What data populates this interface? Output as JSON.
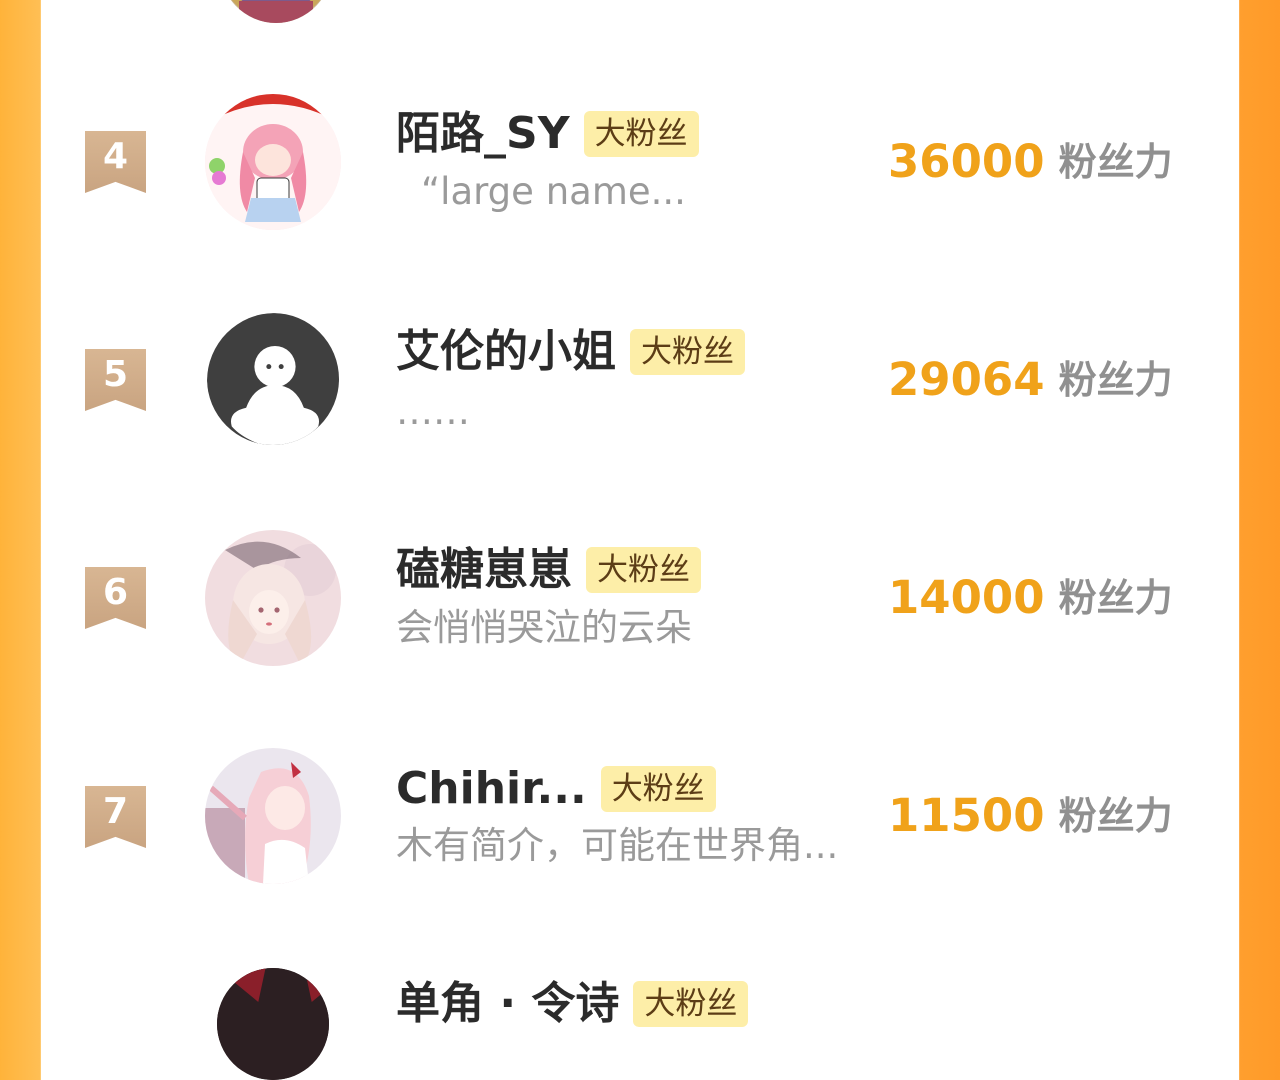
{
  "score_unit": "粉丝力",
  "badge_label": "大粉丝",
  "rows": [
    {
      "rank": "4",
      "name": "陌路_SY",
      "bio": "“large name...",
      "score": "36000",
      "avatar": "anime-girl-avatar"
    },
    {
      "rank": "5",
      "name": "艾伦的小姐",
      "bio": "……",
      "score": "29064",
      "avatar": "default-user-avatar"
    },
    {
      "rank": "6",
      "name": "磕糖崽崽",
      "bio": "会悄悄哭泣的云朵",
      "score": "14000",
      "avatar": "anime-girl-avatar"
    },
    {
      "rank": "7",
      "name": "Chihir...",
      "bio": "木有简介，可能在世界角...",
      "score": "11500",
      "avatar": "anime-girl-avatar"
    }
  ],
  "partial_bottom_row": {
    "name": "单角 · 令诗",
    "badge": "大粉丝"
  },
  "colors": {
    "left_border": "#ffb33a",
    "right_border": "#ff9a28",
    "rank_ribbon": "#cfa987",
    "score": "#f0a21a",
    "badge_bg": "#fdeea8"
  }
}
